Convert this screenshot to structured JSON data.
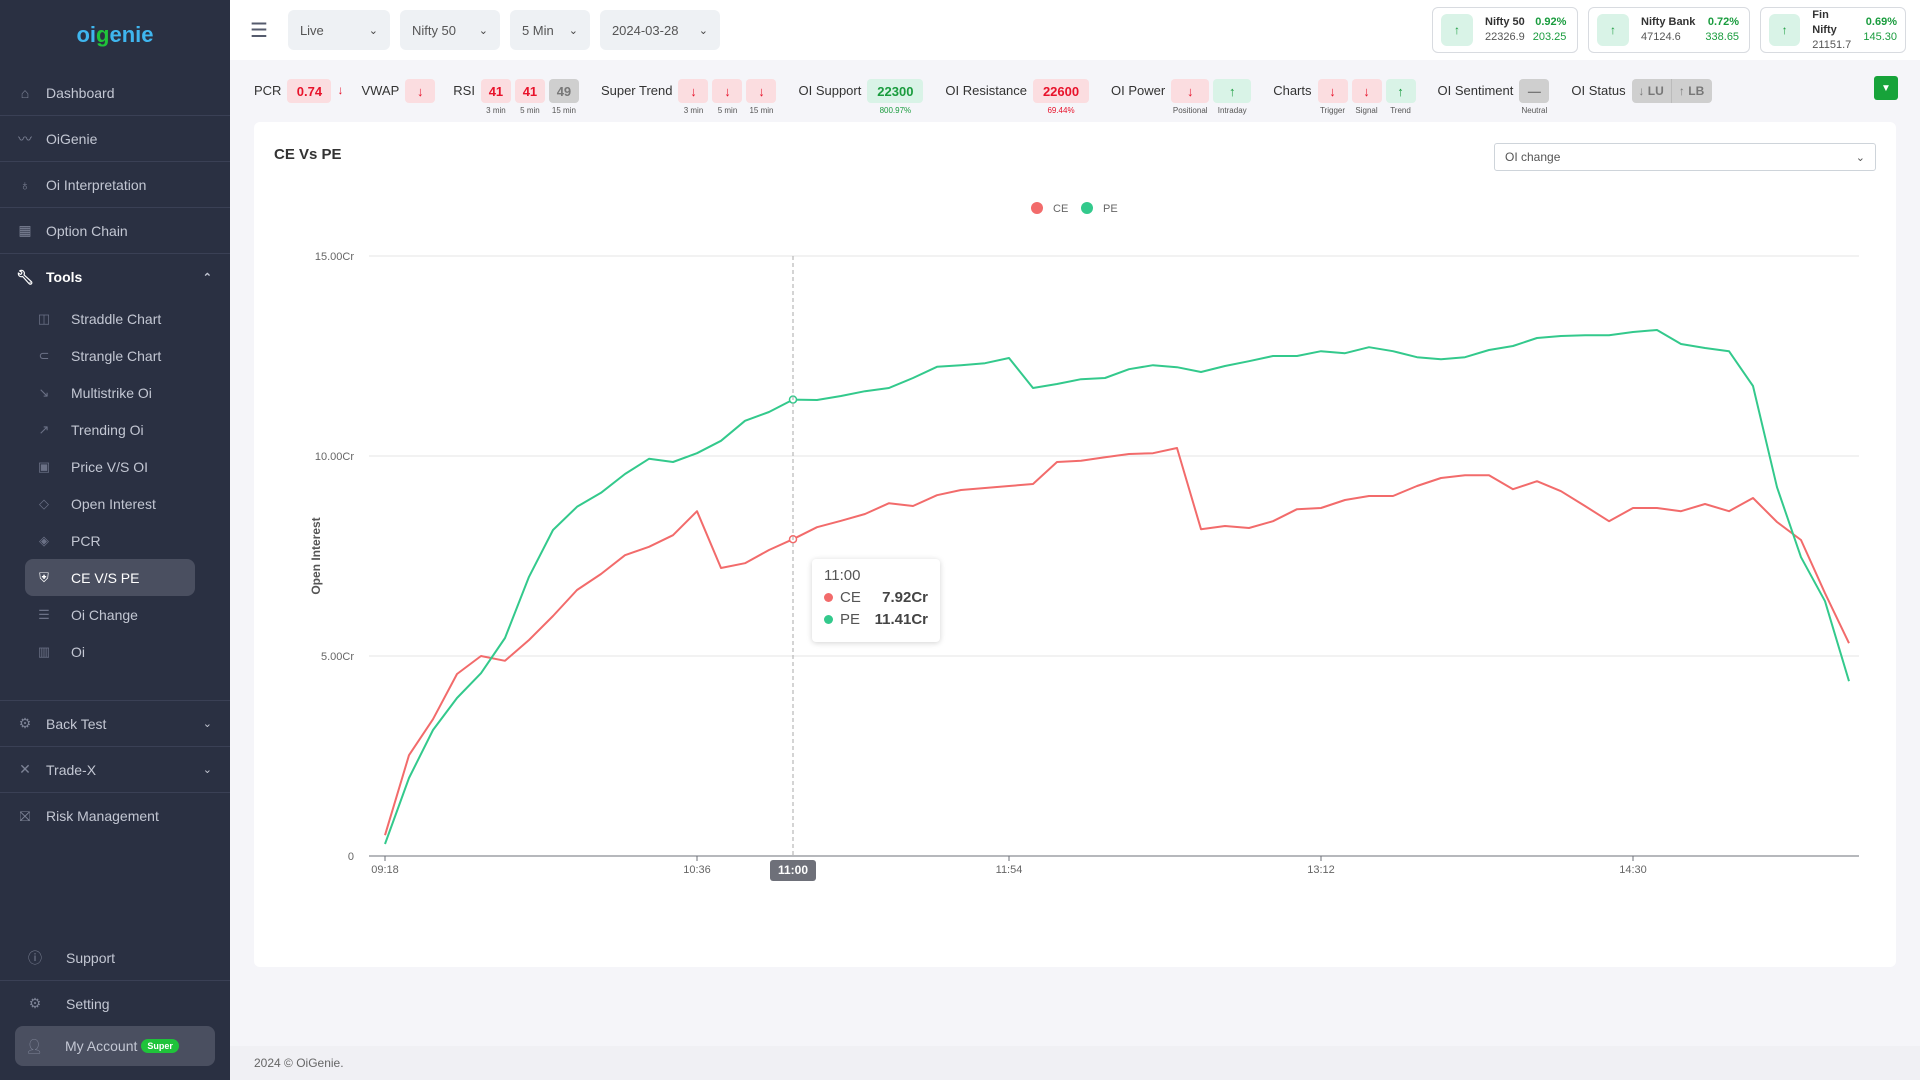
{
  "sidebar": {
    "logo_left": "oi",
    "logo_g": "g",
    "logo_right": "enie",
    "items": [
      {
        "label": "Dashboard",
        "icon": "home-icon"
      },
      {
        "label": "OiGenie",
        "icon": "wave-icon"
      },
      {
        "label": "Oi Interpretation",
        "icon": "lightbulb-icon"
      },
      {
        "label": "Option Chain",
        "icon": "grid-icon"
      }
    ],
    "tools": {
      "label": "Tools",
      "icon": "wrench-icon",
      "sub_items": [
        {
          "label": "Straddle Chart",
          "icon": "chart-box-icon"
        },
        {
          "label": "Strangle Chart",
          "icon": "paperclip-icon"
        },
        {
          "label": "Multistrike Oi",
          "icon": "trend-down-icon"
        },
        {
          "label": "Trending Oi",
          "icon": "trend-up-icon"
        },
        {
          "label": "Price V/S OI",
          "icon": "money-icon"
        },
        {
          "label": "Open Interest",
          "icon": "diamond-icon"
        },
        {
          "label": "PCR",
          "icon": "nodes-icon"
        },
        {
          "label": "CE V/S PE",
          "icon": "shield-icon",
          "active": true
        },
        {
          "label": "Oi Change",
          "icon": "stack-icon"
        },
        {
          "label": "Oi",
          "icon": "bar-chart-icon"
        }
      ]
    },
    "lower_items": [
      {
        "label": "Back Test",
        "icon": "gear-icon"
      },
      {
        "label": "Trade-X",
        "icon": "x-icon"
      },
      {
        "label": "Risk Management",
        "icon": "barrier-icon"
      }
    ],
    "bottom": {
      "support": "Support",
      "setting": "Setting",
      "account": "My Account",
      "account_badge": "Super"
    }
  },
  "topbar": {
    "selects": [
      {
        "value": "Live"
      },
      {
        "value": "Nifty 50"
      },
      {
        "value": "5 Min"
      },
      {
        "value": "2024-03-28"
      }
    ],
    "tickers": [
      {
        "name": "Nifty 50",
        "price": "22326.9",
        "pct": "0.92%",
        "change": "203.25",
        "direction": "up"
      },
      {
        "name": "Nifty Bank",
        "price": "47124.6",
        "pct": "0.72%",
        "change": "338.65",
        "direction": "up"
      },
      {
        "name": "Fin Nifty",
        "price": "21151.7",
        "pct": "0.69%",
        "change": "145.30",
        "direction": "up"
      }
    ]
  },
  "indicators": {
    "pcr": {
      "label": "PCR",
      "value": "0.74",
      "arrow": "↓"
    },
    "vwap": {
      "label": "VWAP",
      "arrow": "↓"
    },
    "rsi": {
      "label": "RSI",
      "cells": [
        {
          "value": "41",
          "caption": "3 min"
        },
        {
          "value": "41",
          "caption": "5 min"
        },
        {
          "value": "49",
          "caption": "15 min"
        }
      ]
    },
    "super_trend": {
      "label": "Super Trend",
      "cells": [
        {
          "value": "↓",
          "caption": "3 min"
        },
        {
          "value": "↓",
          "caption": "5 min"
        },
        {
          "value": "↓",
          "caption": "15 min"
        }
      ]
    },
    "oi_support": {
      "label": "OI Support",
      "value": "22300",
      "caption": "800.97%"
    },
    "oi_resistance": {
      "label": "OI Resistance",
      "value": "22600",
      "caption": "69.44%"
    },
    "oi_power": {
      "label": "OI Power",
      "cells": [
        {
          "value": "↓",
          "caption": "Positional"
        },
        {
          "value": "↑",
          "caption": "Intraday"
        }
      ]
    },
    "charts": {
      "label": "Charts",
      "cells": [
        {
          "value": "↓",
          "caption": "Trigger"
        },
        {
          "value": "↓",
          "caption": "Signal"
        },
        {
          "value": "↑",
          "caption": "Trend"
        }
      ]
    },
    "oi_sentiment": {
      "label": "OI Sentiment",
      "value": "—",
      "caption": "Neutral"
    },
    "oi_status": {
      "label": "OI Status",
      "left": "↓ LU",
      "right": "↑ LB"
    }
  },
  "card": {
    "title": "CE Vs PE",
    "dropdown_value": "OI change"
  },
  "tooltip": {
    "time": "11:00",
    "rows": [
      {
        "name": "CE",
        "value": "7.92Cr"
      },
      {
        "name": "PE",
        "value": "11.41Cr"
      }
    ]
  },
  "footer": "2024 © OiGenie.",
  "colors": {
    "ce": "#f26b6b",
    "pe": "#33c98c",
    "accent_green": "#1fc33a",
    "sidebar_bg": "#2a3042"
  },
  "chart_data": {
    "type": "line",
    "title": "CE Vs PE",
    "xlabel": "",
    "ylabel": "Open Interest",
    "ylim": [
      0,
      15
    ],
    "y_unit": "Cr",
    "y_ticks": [
      "0",
      "5.00Cr",
      "10.00Cr",
      "15.00Cr"
    ],
    "x_start": "09:18",
    "x_step_minutes": 6,
    "x_tick_labels": [
      "09:18",
      "10:36",
      "11:54",
      "13:12",
      "14:30"
    ],
    "highlight_x": "11:00",
    "legend": [
      "CE",
      "PE"
    ],
    "legend_position": "top-center",
    "grid": true,
    "series": [
      {
        "name": "CE",
        "color": "#f26b6b",
        "values": [
          0.52,
          2.52,
          3.42,
          4.55,
          5.0,
          4.88,
          5.4,
          6.0,
          6.65,
          7.05,
          7.52,
          7.73,
          8.02,
          8.62,
          7.2,
          7.32,
          7.65,
          7.92,
          8.22,
          8.38,
          8.55,
          8.82,
          8.75,
          9.02,
          9.15,
          9.2,
          9.25,
          9.3,
          9.85,
          9.88,
          9.97,
          10.05,
          10.07,
          10.2,
          8.17,
          8.25,
          8.2,
          8.37,
          8.67,
          8.7,
          8.9,
          9.0,
          9.0,
          9.25,
          9.45,
          9.52,
          9.52,
          9.17,
          9.37,
          9.12,
          8.75,
          8.37,
          8.7,
          8.7,
          8.62,
          8.8,
          8.62,
          8.95,
          8.35,
          7.9,
          6.57,
          5.32
        ]
      },
      {
        "name": "PE",
        "color": "#33c98c",
        "values": [
          0.3,
          1.95,
          3.15,
          3.95,
          4.57,
          5.45,
          6.98,
          8.15,
          8.73,
          9.08,
          9.55,
          9.93,
          9.85,
          10.07,
          10.38,
          10.88,
          11.1,
          11.41,
          11.4,
          11.5,
          11.62,
          11.7,
          11.95,
          12.23,
          12.27,
          12.32,
          12.45,
          11.7,
          11.8,
          11.92,
          11.95,
          12.17,
          12.27,
          12.22,
          12.1,
          12.25,
          12.37,
          12.5,
          12.5,
          12.62,
          12.57,
          12.72,
          12.62,
          12.47,
          12.42,
          12.47,
          12.65,
          12.75,
          12.95,
          13.0,
          13.02,
          13.02,
          13.1,
          13.15,
          12.8,
          12.7,
          12.62,
          11.75,
          9.22,
          7.47,
          6.37,
          4.37
        ]
      }
    ]
  }
}
